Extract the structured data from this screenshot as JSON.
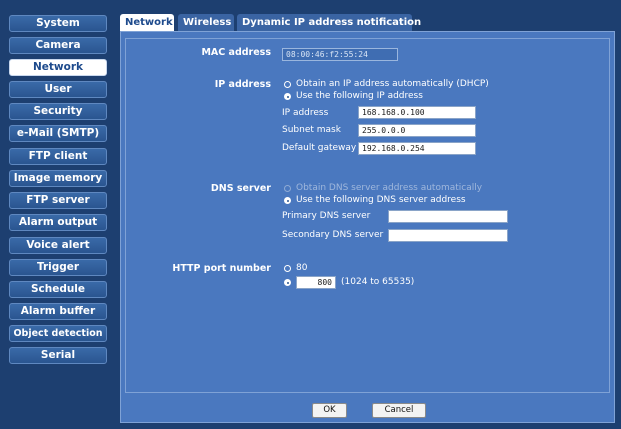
{
  "sidebar": {
    "items": [
      {
        "label": "System",
        "active": false
      },
      {
        "label": "Camera",
        "active": false
      },
      {
        "label": "Network",
        "active": true
      },
      {
        "label": "User",
        "active": false
      },
      {
        "label": "Security",
        "active": false
      },
      {
        "label": "e-Mail (SMTP)",
        "active": false
      },
      {
        "label": "FTP client",
        "active": false
      },
      {
        "label": "Image memory",
        "active": false
      },
      {
        "label": "FTP server",
        "active": false
      },
      {
        "label": "Alarm output",
        "active": false
      },
      {
        "label": "Voice alert",
        "active": false
      },
      {
        "label": "Trigger",
        "active": false
      },
      {
        "label": "Schedule",
        "active": false
      },
      {
        "label": "Alarm buffer",
        "active": false
      },
      {
        "label": "Object detection",
        "active": false
      },
      {
        "label": "Serial",
        "active": false
      }
    ]
  },
  "tabs": [
    {
      "label": "Network",
      "active": true
    },
    {
      "label": "Wireless",
      "active": false
    },
    {
      "label": "Dynamic IP address notification",
      "active": false
    }
  ],
  "form": {
    "mac": {
      "label": "MAC address",
      "value": "08:00:46:f2:55:24"
    },
    "ip": {
      "label": "IP address",
      "option_dhcp": "Obtain an IP address automatically (DHCP)",
      "option_static": "Use the following IP address",
      "selected": "static",
      "ip_label": "IP address",
      "ip_value": "168.168.0.100",
      "mask_label": "Subnet mask",
      "mask_value": "255.0.0.0",
      "gateway_label": "Default gateway",
      "gateway_value": "192.168.0.254"
    },
    "dns": {
      "label": "DNS server",
      "option_auto": "Obtain DNS server address automatically",
      "option_manual": "Use the following DNS server address",
      "selected": "manual",
      "primary_label": "Primary DNS server",
      "primary_value": "",
      "secondary_label": "Secondary DNS server",
      "secondary_value": ""
    },
    "http": {
      "label": "HTTP port number",
      "option_default": "80",
      "selected": "custom",
      "custom_value": "800",
      "range_text": "(1024 to 65535)"
    }
  },
  "buttons": {
    "ok": "OK",
    "cancel": "Cancel"
  },
  "colors": {
    "background": "#1d3f70",
    "panel": "#4a78bf",
    "active_text": "#1d4a8c"
  }
}
